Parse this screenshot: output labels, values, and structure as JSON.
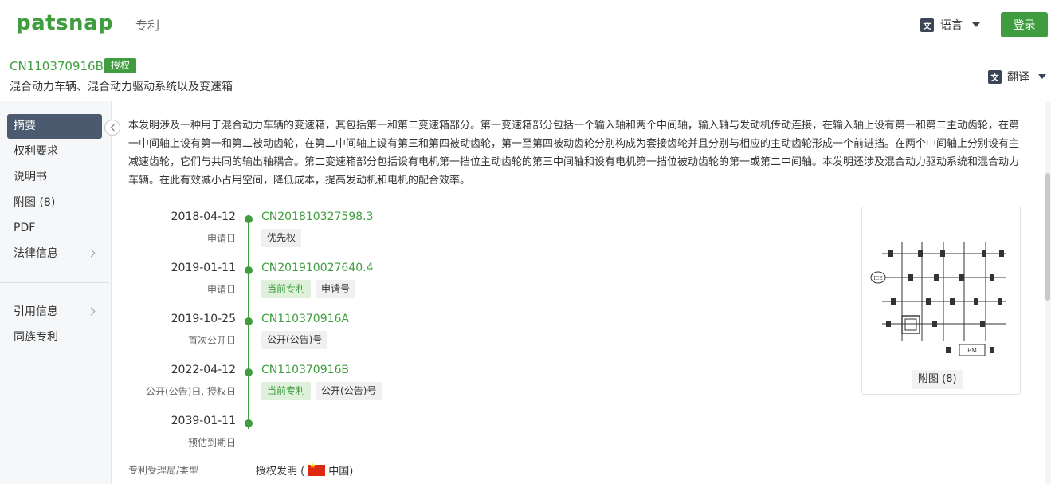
{
  "header": {
    "logo": "patsnap",
    "section": "专利",
    "language_label": "语言",
    "login_label": "登录"
  },
  "document": {
    "pub_number": "CN110370916B",
    "status_badge": "授权",
    "title": "混合动力车辆、混合动力驱动系统以及变速箱",
    "translate_label": "翻译"
  },
  "sidebar": {
    "items": [
      {
        "label": "摘要",
        "active": true
      },
      {
        "label": "权利要求"
      },
      {
        "label": "说明书"
      },
      {
        "label": "附图 (8)"
      },
      {
        "label": "PDF"
      },
      {
        "label": "法律信息"
      },
      {
        "label": "引用信息"
      },
      {
        "label": "同族专利"
      }
    ]
  },
  "abstract": "本发明涉及一种用于混合动力车辆的变速箱，其包括第一和第二变速箱部分。第一变速箱部分包括一个输入轴和两个中间轴，输入轴与发动机传动连接，在输入轴上设有第一和第二主动齿轮，在第一中间轴上设有第一和第二被动齿轮，在第二中间轴上设有第三和第四被动齿轮，第一至第四被动齿轮分别构成为套接齿轮并且分别与相应的主动齿轮形成一个前进挡。在两个中间轴上分别设有主减速齿轮，它们与共同的输出轴耦合。第二变速箱部分包括设有电机第一挡位主动齿轮的第三中间轴和设有电机第一挡位被动齿轮的第一或第二中间轴。本发明还涉及混合动力驱动系统和混合动力车辆。在此有效减小占用空间，降低成本，提高发动机和电机的配合效率。",
  "timeline": [
    {
      "date": "2018-04-12",
      "label": "申请日",
      "number": "CN201810327598.3",
      "tags": [
        {
          "text": "优先权",
          "current": false
        }
      ]
    },
    {
      "date": "2019-01-11",
      "label": "申请日",
      "number": "CN201910027640.4",
      "tags": [
        {
          "text": "当前专利",
          "current": true
        },
        {
          "text": "申请号",
          "current": false
        }
      ]
    },
    {
      "date": "2019-10-25",
      "label": "首次公开日",
      "number": "CN110370916A",
      "tags": [
        {
          "text": "公开(公告)号",
          "current": false
        }
      ]
    },
    {
      "date": "2022-04-12",
      "label": "公开(公告)日, 授权日",
      "number": "CN110370916B",
      "tags": [
        {
          "text": "当前专利",
          "current": true
        },
        {
          "text": "公开(公告)号",
          "current": false
        }
      ]
    },
    {
      "date": "2039-01-11",
      "label": "预估到期日",
      "number": "",
      "tags": []
    }
  ],
  "figure": {
    "caption": "附图 (8)",
    "labels": {
      "engine": "ICE",
      "motor": "EM"
    }
  },
  "meta": {
    "key": "专利受理局/类型",
    "value_prefix": "授权发明 (",
    "country": "中国)"
  },
  "colors": {
    "brand": "#3f9d3f",
    "nav_active": "#4c5a6f"
  }
}
